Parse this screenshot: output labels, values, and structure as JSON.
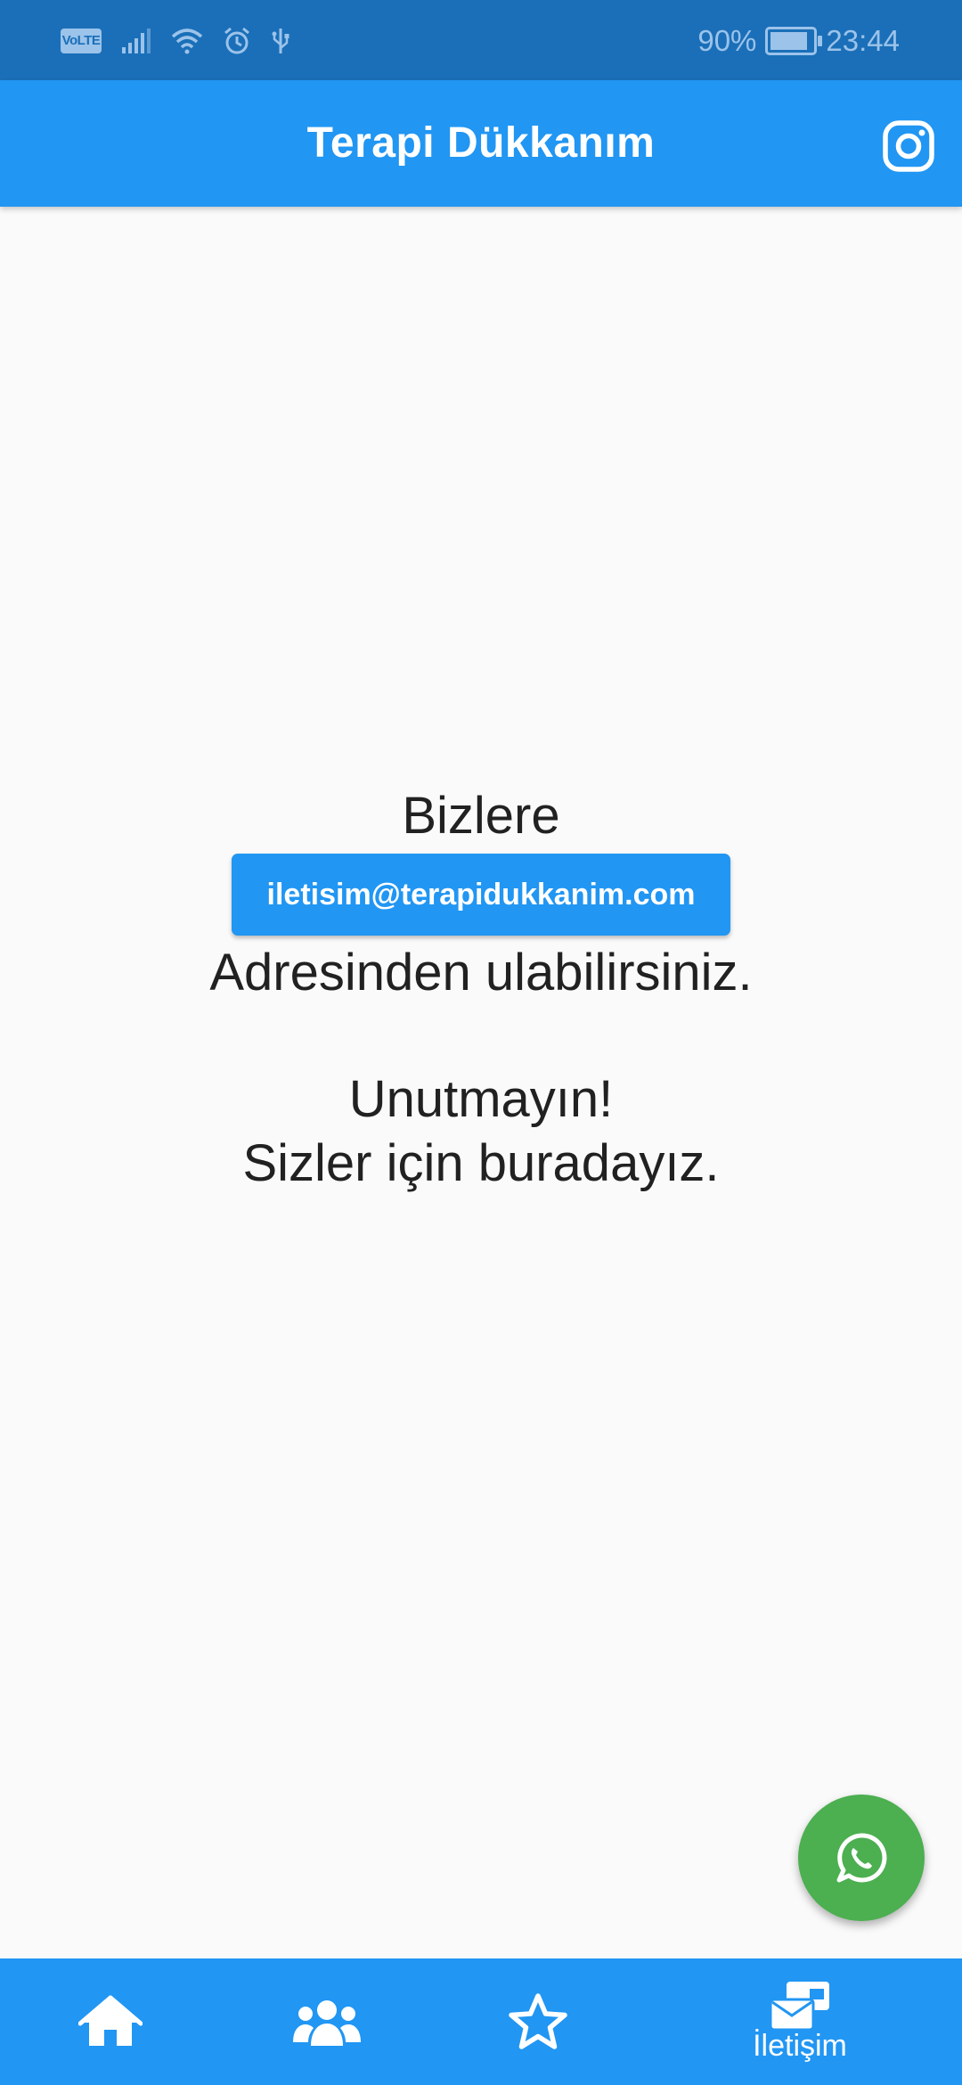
{
  "status_bar": {
    "battery_percent": "90%",
    "battery_level": 0.9,
    "time": "23:44",
    "volte_label": "VoLTE",
    "icons": [
      "signal-icon",
      "wifi-icon",
      "alarm-icon",
      "usb-icon",
      "battery-charging-icon"
    ]
  },
  "app_bar": {
    "title": "Terapi Dükkanım",
    "action_icon": "instagram-icon"
  },
  "content": {
    "line1": "Bizlere",
    "email_button": "iletisim@terapidukkanim.com",
    "line2": "Adresinden ulabilirsiniz.",
    "line3": "Unutmayın!",
    "line4": "Sizler için buradayız."
  },
  "fab": {
    "icon": "whatsapp-icon"
  },
  "bottom_nav": {
    "items": [
      {
        "icon": "home-icon",
        "label": ""
      },
      {
        "icon": "users-icon",
        "label": ""
      },
      {
        "icon": "star-icon",
        "label": ""
      },
      {
        "icon": "contact-mail-icon",
        "label": "İletişim"
      }
    ],
    "selected_index": 3
  },
  "colors": {
    "status_bar": "#1a6fb8",
    "primary": "#2196f3",
    "background": "#fafafa",
    "text": "#212121",
    "fab": "#4caf50",
    "on_primary": "#ffffff"
  }
}
